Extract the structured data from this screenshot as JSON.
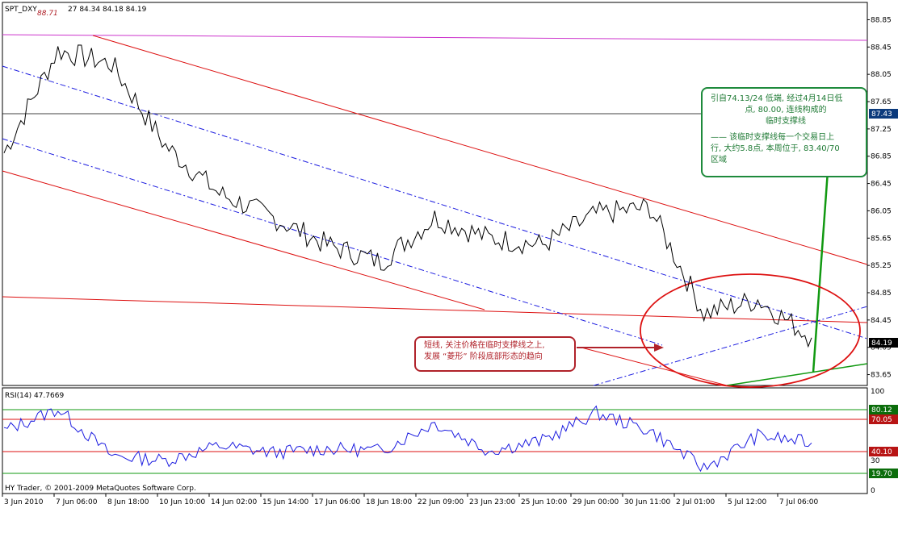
{
  "header": {
    "symbol": "SPT_DXY",
    "ohlc": "27 84.34 84.18 84.19",
    "high_mark": "88.71"
  },
  "indicator": {
    "title": "RSI(14) 47.7669"
  },
  "copyright": "HY Trader, © 2001-2009 MetaQuotes Software Corp.",
  "price_axis": {
    "ticks": [
      "88.85",
      "88.45",
      "88.05",
      "87.65",
      "87.25",
      "86.85",
      "86.45",
      "86.05",
      "85.65",
      "85.25",
      "84.85",
      "84.45",
      "84.05",
      "83.65"
    ],
    "current_price": "84.19",
    "marker_price": "87.43"
  },
  "rsi_axis": {
    "ticks": [
      "100",
      "70",
      "30",
      "0"
    ],
    "markers": [
      "80.12",
      "70.05",
      "40.10",
      "19.70"
    ]
  },
  "time_axis": {
    "labels": [
      "3 Jun 2010",
      "7 Jun 06:00",
      "8 Jun 18:00",
      "10 Jun 10:00",
      "14 Jun 02:00",
      "15 Jun 14:00",
      "17 Jun 06:00",
      "18 Jun 18:00",
      "22 Jun 09:00",
      "23 Jun 23:00",
      "25 Jun 10:00",
      "29 Jun 00:00",
      "30 Jun 11:00",
      "2 Jul 01:00",
      "5 Jul 12:00",
      "7 Jul 06:00"
    ]
  },
  "annotations": {
    "left": [
      "短线, 关注价格在临时支撑线之上,",
      "发展 “菱形” 阶段底部形态的趋向"
    ],
    "right": [
      "引自74.13/24 低端, 经过4月14日低",
      "点, 80.00, 连线构成的",
      "临时支撑线",
      "—— 该临时支撑线每一个交易日上",
      "行, 大约5.8点, 本周位于, 83.40/70",
      "区域"
    ]
  },
  "colors": {
    "price": "#000000",
    "channel": "#dd1111",
    "midline": "#1c1ce0",
    "support": "#119911",
    "rsi_line": "#1c1ce0",
    "marker_bg": "#0b3a7c",
    "rsi_marker_green": "#0b6d0b",
    "rsi_marker_red": "#b81414"
  },
  "chart_data": {
    "type": "line",
    "title": "SPT_DXY",
    "ylim": [
      83.55,
      88.95
    ],
    "x": [
      "3 Jun 2010",
      "7 Jun 06:00",
      "8 Jun 18:00",
      "10 Jun 10:00",
      "14 Jun 02:00",
      "15 Jun 14:00",
      "17 Jun 06:00",
      "18 Jun 18:00",
      "22 Jun 09:00",
      "23 Jun 23:00",
      "25 Jun 10:00",
      "29 Jun 00:00",
      "30 Jun 11:00",
      "2 Jul 01:00",
      "5 Jul 12:00",
      "7 Jul 06:00"
    ],
    "series": [
      {
        "values": [
          86.9,
          88.4,
          88.2,
          87.0,
          86.3,
          85.95,
          85.55,
          85.3,
          85.95,
          85.65,
          85.55,
          86.0,
          86.1,
          84.55,
          84.75,
          84.19
        ]
      },
      {
        "name": "RSI(14)",
        "values": [
          60,
          82,
          35,
          30,
          45,
          38,
          42,
          40,
          68,
          40,
          50,
          78,
          60,
          22,
          55,
          47.77
        ],
        "ylim": [
          0,
          100
        ]
      }
    ]
  }
}
